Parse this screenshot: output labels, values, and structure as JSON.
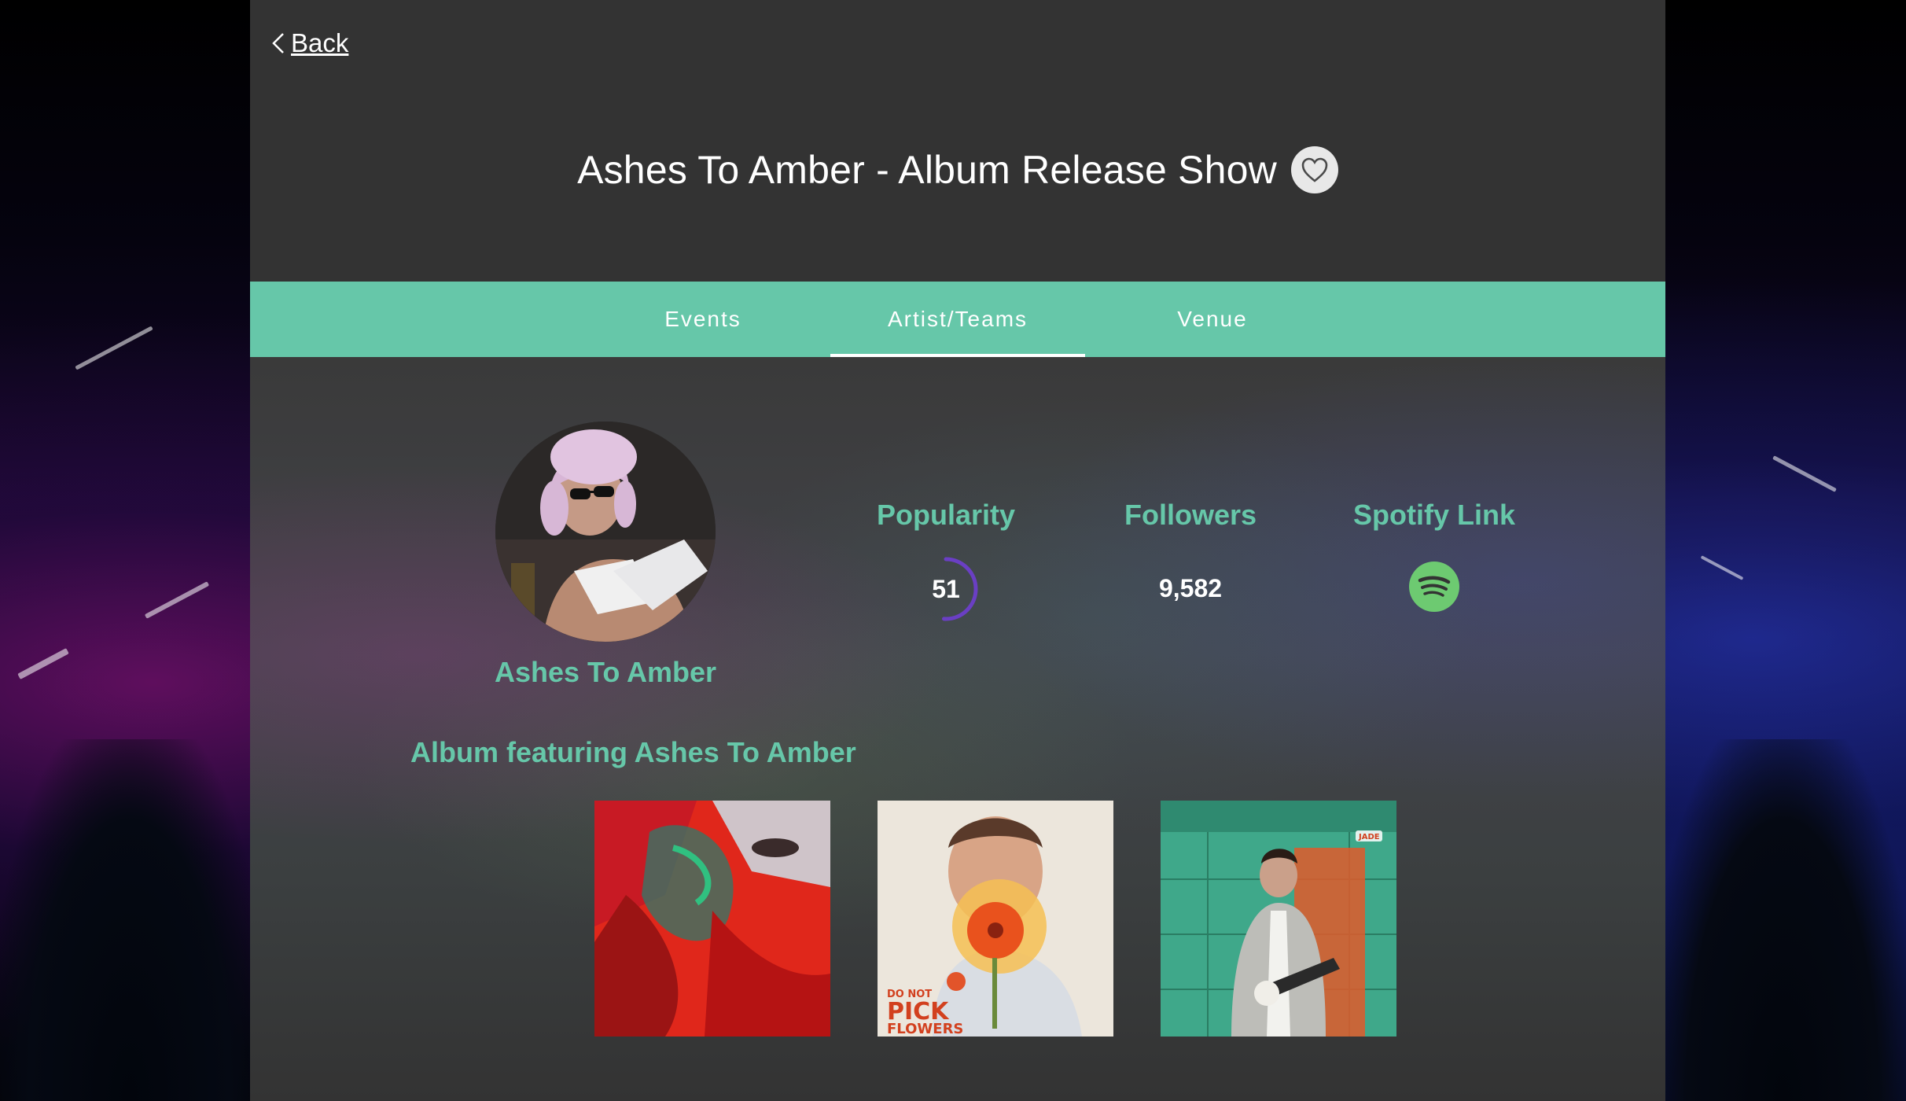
{
  "header": {
    "back_label": "Back",
    "title": "Ashes To Amber - Album Release Show",
    "favorite_icon": "heart-outline-icon"
  },
  "tabs": [
    {
      "label": "Events",
      "active": false
    },
    {
      "label": "Artist/Teams",
      "active": true
    },
    {
      "label": "Venue",
      "active": false
    }
  ],
  "artist": {
    "name": "Ashes To Amber",
    "popularity_label": "Popularity",
    "popularity": "51",
    "followers_label": "Followers",
    "followers": "9,582",
    "spotify_label": "Spotify Link",
    "spotify_icon": "spotify-icon"
  },
  "albums": {
    "heading": "Album featuring Ashes To Amber",
    "items": [
      {
        "cover_text": ""
      },
      {
        "cover_text": "DO NOT PICK THE FLOWERS"
      },
      {
        "cover_text": "JADE"
      }
    ]
  },
  "colors": {
    "accent": "#66c7a9",
    "panel": "#323232",
    "gauge": "#6a3fc4",
    "spotify": "#6dca71"
  }
}
